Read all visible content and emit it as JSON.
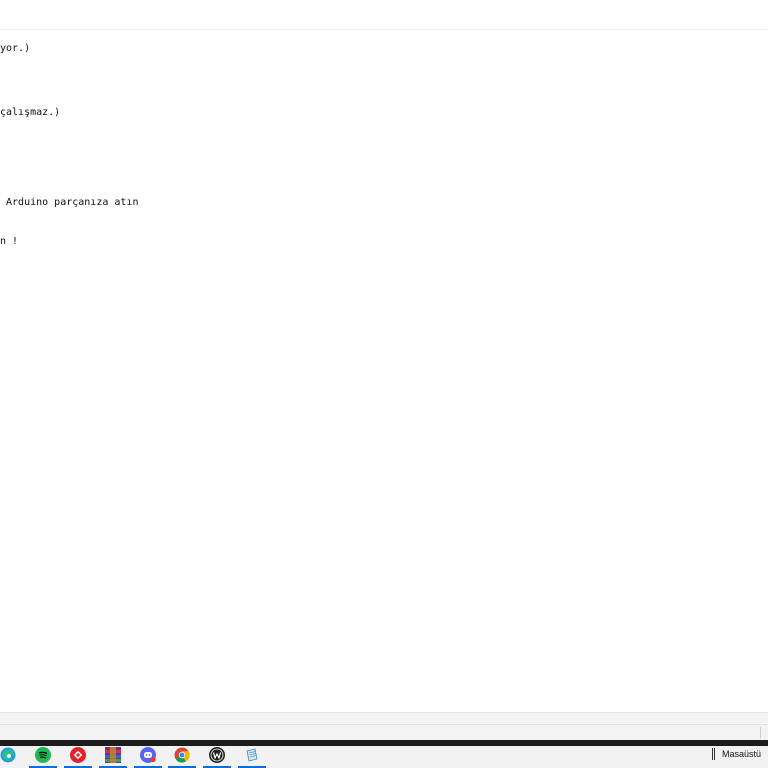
{
  "editor": {
    "lines": [
      "yor.)",
      "çalışmaz.)",
      " Arduino parçanıza atın",
      "n !"
    ]
  },
  "taskbar": {
    "items": [
      {
        "name": "edge-icon",
        "color": "#1a8ae0"
      },
      {
        "name": "spotify-icon",
        "color": "#1db954"
      },
      {
        "name": "anydesk-icon",
        "color": "#e8202a"
      },
      {
        "name": "winrar-icon",
        "color": "#7a2a8a"
      },
      {
        "name": "discord-icon",
        "color": "#5865f2"
      },
      {
        "name": "chrome-icon",
        "color": "#fbbc05"
      },
      {
        "name": "app-w-icon",
        "color": "#222222"
      },
      {
        "name": "notepad-icon",
        "color": "#6aa8d8"
      }
    ],
    "desktop_label": "Masaüstü"
  },
  "colors": {
    "accent": "#0a6fd6",
    "taskbar_bg": "#f2f2f2"
  }
}
